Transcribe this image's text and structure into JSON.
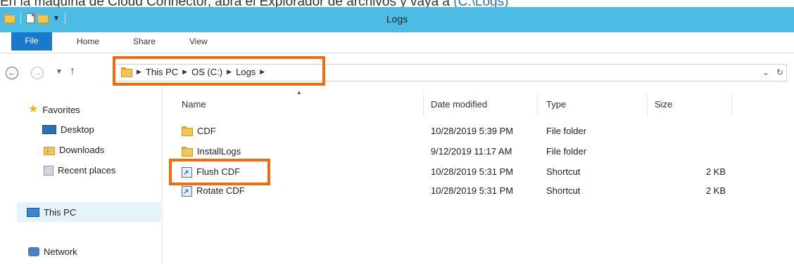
{
  "caption": {
    "text_before": "En la máquina de Cloud Connector, abra el Explorador de archivos y vaya a ",
    "path_link": "C:\\Logs"
  },
  "window": {
    "title": "Logs"
  },
  "ribbon": {
    "tabs": [
      "File",
      "Home",
      "Share",
      "View"
    ]
  },
  "address": {
    "crumbs": [
      "This PC",
      "OS (C:)",
      "Logs"
    ],
    "dropdown_icon": "chevron-down-icon",
    "refresh_icon": "refresh-icon"
  },
  "sidebar": {
    "favorites": "Favorites",
    "items": [
      "Desktop",
      "Downloads",
      "Recent places"
    ],
    "this_pc": "This PC",
    "network": "Network"
  },
  "columns": {
    "name": "Name",
    "date": "Date modified",
    "type": "Type",
    "size": "Size"
  },
  "files": [
    {
      "name": "CDF",
      "date": "10/28/2019 5:39 PM",
      "type": "File folder",
      "size": "",
      "icon": "folder-icon"
    },
    {
      "name": "InstallLogs",
      "date": "9/12/2019 11:17 AM",
      "type": "File folder",
      "size": "",
      "icon": "folder-icon"
    },
    {
      "name": "Flush CDF",
      "date": "10/28/2019 5:31 PM",
      "type": "Shortcut",
      "size": "2 KB",
      "icon": "shortcut-icon"
    },
    {
      "name": "Rotate CDF",
      "date": "10/28/2019 5:31 PM",
      "type": "Shortcut",
      "size": "2 KB",
      "icon": "shortcut-icon"
    }
  ],
  "highlight_color": "#f26b0f",
  "titlebar_color": "#4dbce5",
  "file_tab_color": "#1979ca"
}
